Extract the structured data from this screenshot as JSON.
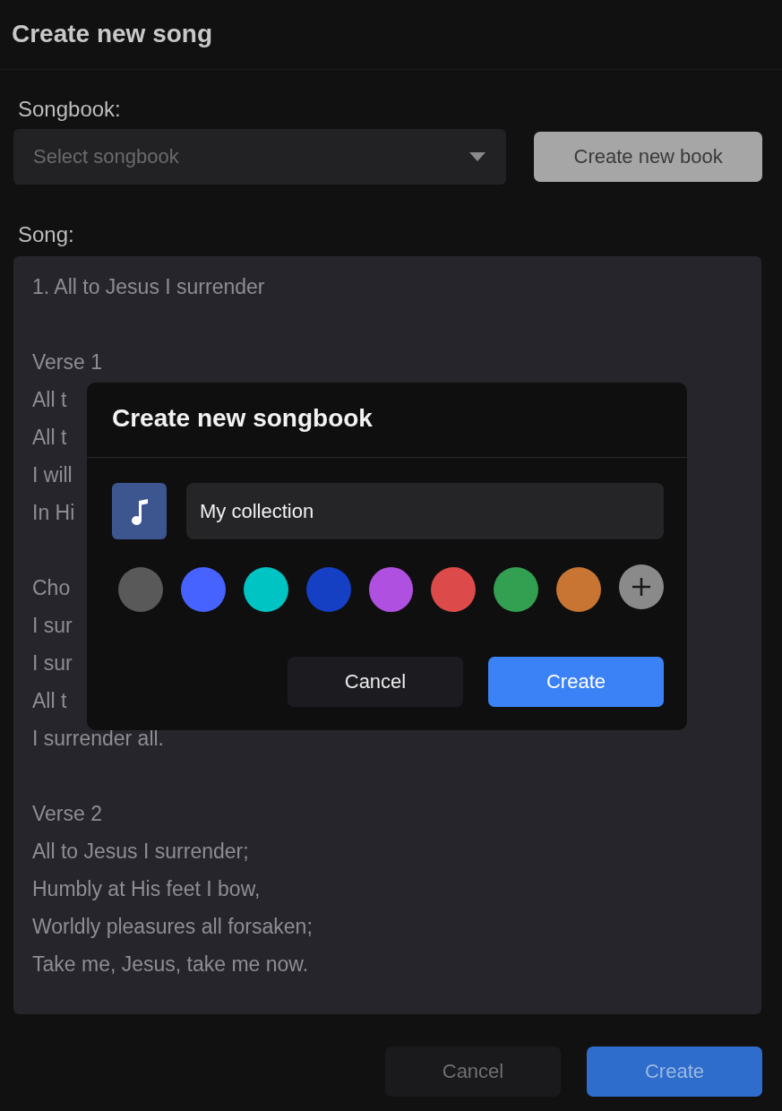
{
  "page": {
    "title": "Create new song",
    "songbook_label": "Songbook:",
    "songbook_select": {
      "placeholder": "Select songbook"
    },
    "create_book_button": "Create new book",
    "song_label": "Song:",
    "song_text": [
      [
        "1. All to Jesus I surrender"
      ],
      [
        "Verse 1",
        "All t",
        "All t",
        "I will",
        "In Hi"
      ],
      [
        "Cho",
        "I sur",
        "I sur",
        "All t",
        "I surrender all."
      ],
      [
        "Verse 2",
        "All to Jesus I surrender;",
        "Humbly at His feet I bow,",
        "Worldly pleasures all forsaken;",
        "Take me, Jesus, take me now."
      ]
    ],
    "buttons": [
      {
        "label": "Cancel",
        "kind": "secondary"
      },
      {
        "label": "Create",
        "kind": "primary"
      }
    ]
  },
  "dialog": {
    "title": "Create new songbook",
    "name_field": {
      "value": "My collection"
    },
    "colors": [
      {
        "color": "#595959"
      },
      {
        "color": "#4763ff"
      },
      {
        "color": "#00c4c4"
      },
      {
        "color": "#1640c4"
      },
      {
        "color": "#b050e0"
      },
      {
        "color": "#dc4a4a"
      },
      {
        "color": "#32a050"
      },
      {
        "color": "#c87432"
      }
    ],
    "buttons": [
      {
        "label": "Cancel",
        "kind": "secondary"
      },
      {
        "label": "Create",
        "kind": "primary"
      }
    ]
  }
}
